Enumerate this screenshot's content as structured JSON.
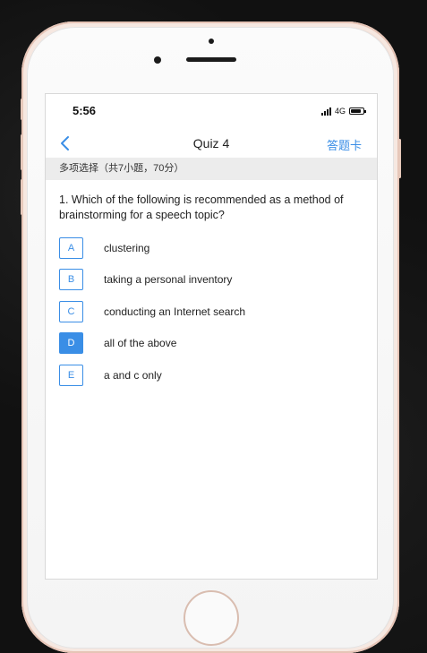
{
  "status_bar": {
    "time": "5:56",
    "network": "4G"
  },
  "nav": {
    "title": "Quiz 4",
    "answer_card": "答题卡"
  },
  "section": {
    "header": "多项选择（共7小题，70分）"
  },
  "question": {
    "text": "1. Which of the following is recommended as a method of brainstorming for a speech topic?",
    "options": [
      {
        "letter": "A",
        "text": "clustering",
        "selected": false
      },
      {
        "letter": "B",
        "text": "taking a personal inventory",
        "selected": false
      },
      {
        "letter": "C",
        "text": "conducting an Internet search",
        "selected": false
      },
      {
        "letter": "D",
        "text": "all of the above",
        "selected": true
      },
      {
        "letter": "E",
        "text": "a and c only",
        "selected": false
      }
    ]
  },
  "colors": {
    "accent": "#3a8ee6",
    "section_bg": "#ececec"
  },
  "icons": {
    "back": "chevron-left-icon",
    "signal": "signal-bars-icon",
    "battery": "battery-icon"
  }
}
